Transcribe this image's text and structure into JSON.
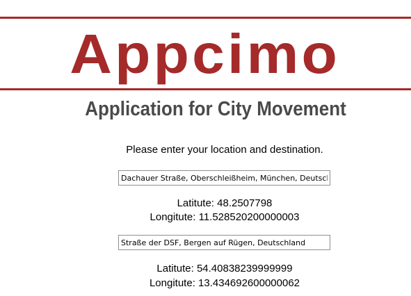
{
  "header": {
    "brand": "Appcimo",
    "subtitle": "Application for City Movement"
  },
  "form": {
    "prompt": "Please enter your location and destination.",
    "origin": {
      "value": "Dachauer Straße, Oberschleißheim, München, Deutschland",
      "latitude_label": "Latitute: ",
      "latitude": "48.2507798",
      "longitude_label": "Longitute: ",
      "longitude": "11.528520200000003"
    },
    "destination": {
      "value": "Straße der DSF, Bergen auf Rügen, Deutschland",
      "latitude_label": "Latitute: ",
      "latitude": "54.40838239999999",
      "longitude_label": "Longitute: ",
      "longitude": "13.434692600000062"
    }
  },
  "colors": {
    "brand": "#a52a2a",
    "subtitle": "#4a4a4a"
  }
}
